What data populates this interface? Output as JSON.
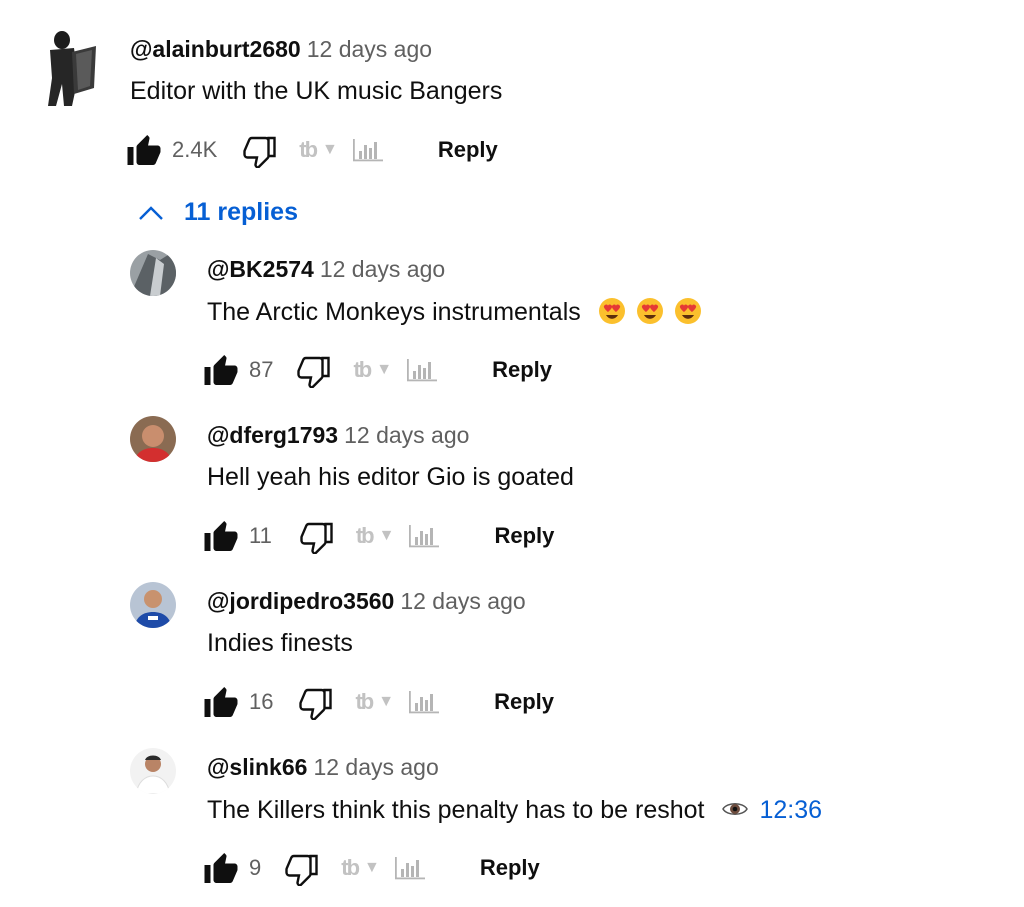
{
  "comments": [
    {
      "author": "@alainburt2680",
      "time": "12 days ago",
      "text": "Editor with the UK music Bangers",
      "likes": "2.4K",
      "reply_label": "Reply"
    }
  ],
  "replies_toggle": {
    "label": "11 replies"
  },
  "replies": [
    {
      "author": "@BK2574",
      "time": "12 days ago",
      "text": "The Arctic Monkeys instrumentals",
      "likes": "87",
      "reply_label": "Reply"
    },
    {
      "author": "@dferg1793",
      "time": "12 days ago",
      "text": "Hell yeah his editor Gio is goated",
      "likes": "11",
      "reply_label": "Reply"
    },
    {
      "author": "@jordipedro3560",
      "time": "12 days ago",
      "text": "Indies finests",
      "likes": "16",
      "reply_label": "Reply"
    },
    {
      "author": "@slink66",
      "time": "12 days ago",
      "text": "The Killers think this penalty has to be reshot",
      "timestamp_link": "12:36",
      "likes": "9",
      "reply_label": "Reply"
    }
  ],
  "icons": {
    "like": "thumbs-up-icon",
    "dislike": "thumbs-down-icon",
    "tb": "tubebuddy-icon",
    "stats": "bar-chart-icon",
    "collapse": "chevron-up-icon",
    "emoji": "heart-eyes-emoji",
    "eye": "eye-emoji"
  },
  "colors": {
    "link": "#065fd4",
    "muted": "#606060",
    "text": "#0f0f0f"
  },
  "tubebuddy": {
    "logo_text": "tb"
  }
}
